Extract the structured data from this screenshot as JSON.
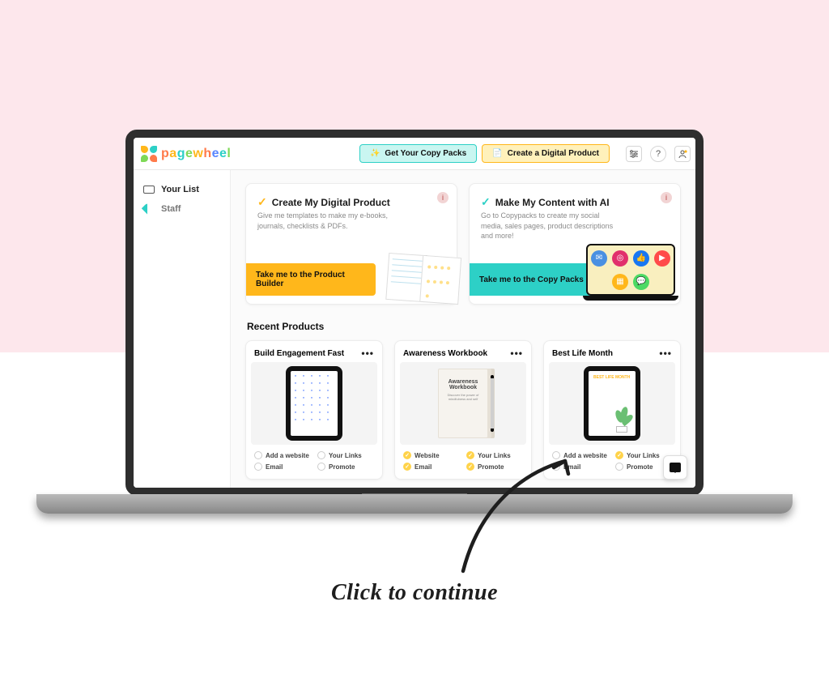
{
  "header": {
    "brand": "pagewheel",
    "copy_packs_btn": "Get Your Copy Packs",
    "create_product_btn": "Create a Digital Product"
  },
  "sidebar": {
    "items": [
      {
        "label": "Your List",
        "icon": "mail"
      },
      {
        "label": "Staff",
        "icon": "rocket"
      }
    ]
  },
  "cards": {
    "product": {
      "title": "Create My Digital Product",
      "desc": "Give me templates to make my e-books, journals, checklists & PDFs.",
      "cta": "Take me to the Product Builder"
    },
    "ai": {
      "title": "Make My Content with AI",
      "desc": "Go to Copypacks to create my social media, sales pages, product descriptions and more!",
      "cta": "Take me to the Copy Packs"
    }
  },
  "recent": {
    "heading": "Recent Products",
    "link_labels": {
      "website_add": "Add a website",
      "website_done": "Website",
      "links": "Your Links",
      "email": "Email",
      "promote": "Promote"
    },
    "products": [
      {
        "title": "Build Engagement Fast",
        "thumb": "tablet-doodles",
        "states": {
          "website": false,
          "links": false,
          "email": false,
          "promote": false
        }
      },
      {
        "title": "Awareness Workbook",
        "thumb": "workbook",
        "thumb_title": "Awareness Workbook",
        "states": {
          "website": true,
          "links": true,
          "email": true,
          "promote": true
        }
      },
      {
        "title": "Best Life Month",
        "thumb": "tablet-bestlife",
        "thumb_title": "BEST LIFE MONTH",
        "states": {
          "website": false,
          "links": true,
          "email": false,
          "promote": false
        }
      }
    ]
  },
  "annotation": {
    "caption": "Click to continue"
  }
}
